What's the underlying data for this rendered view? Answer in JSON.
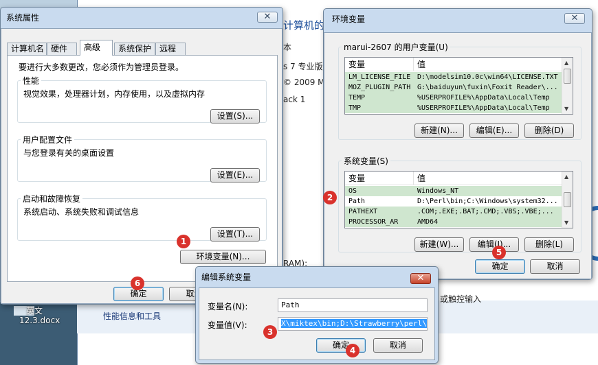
{
  "background": {
    "title": "计算机的",
    "lines": [
      "本",
      "s 7 专业版",
      "© 2009 M",
      "ack 1",
      "RAM):",
      "或触控输入"
    ],
    "task_link": "性能信息和工具",
    "desktop_lines": [
      "英文",
      "12.3.docx"
    ]
  },
  "sys_props": {
    "title": "系统属性",
    "close_label": "✕",
    "tabs": [
      "计算机名",
      "硬件",
      "高级",
      "系统保护",
      "远程"
    ],
    "active_tab": "高级",
    "admin_note": "要进行大多数更改，您必须作为管理员登录。",
    "performance": {
      "label": "性能",
      "desc": "视觉效果，处理器计划，内存使用，以及虚拟内存",
      "button": "设置(S)..."
    },
    "profiles": {
      "label": "用户配置文件",
      "desc": "与您登录有关的桌面设置",
      "button": "设置(E)..."
    },
    "startup": {
      "label": "启动和故障恢复",
      "desc": "系统启动、系统失败和调试信息",
      "button": "设置(T)..."
    },
    "env_button": "环境变量(N)...",
    "ok": "确定",
    "cancel": "取消"
  },
  "env_vars": {
    "title": "环境变量",
    "close_label": "✕",
    "user_group": "marui-2607 的用户变量(U)",
    "user_headers": [
      "变量",
      "值"
    ],
    "user_rows": [
      [
        "LM_LICENSE_FILE",
        "D:\\modelsim10.0c\\win64\\LICENSE.TXT"
      ],
      [
        "MOZ_PLUGIN_PATH",
        "G:\\baiduyun\\fuxin\\Foxit Reader\\..."
      ],
      [
        "TEMP",
        "%USERPROFILE%\\AppData\\Local\\Temp"
      ],
      [
        "TMP",
        "%USERPROFILE%\\AppData\\Local\\Temp"
      ]
    ],
    "user_buttons": [
      "新建(N)...",
      "编辑(E)...",
      "删除(D)"
    ],
    "sys_group": "系统变量(S)",
    "sys_headers": [
      "变量",
      "值"
    ],
    "sys_rows": [
      [
        "OS",
        "Windows_NT"
      ],
      [
        "Path",
        "D:\\Perl\\bin;C:\\Windows\\system32..."
      ],
      [
        "PATHEXT",
        ".COM;.EXE;.BAT;.CMD;.VBS;.VBE;..."
      ],
      [
        "PROCESSOR_AR",
        "AMD64"
      ]
    ],
    "sys_buttons": [
      "新建(W)...",
      "编辑(I)...",
      "删除(L)"
    ],
    "ok": "确定",
    "cancel": "取消"
  },
  "edit_var": {
    "title": "编辑系统变量",
    "close_label": "✕",
    "name_label": "变量名(N):",
    "name_value": "Path",
    "value_label": "变量值(V):",
    "value_value": "X\\miktex\\bin;D:\\Strawberry\\perl\\bin",
    "ok": "确定",
    "cancel": "取消"
  },
  "markers": [
    "1",
    "2",
    "3",
    "4",
    "5",
    "6"
  ],
  "colors": {
    "marker": "#d9322c",
    "selection": "#3399ff",
    "row_highlight": "#cfe6cf",
    "title_bg": "#c9dbef"
  }
}
